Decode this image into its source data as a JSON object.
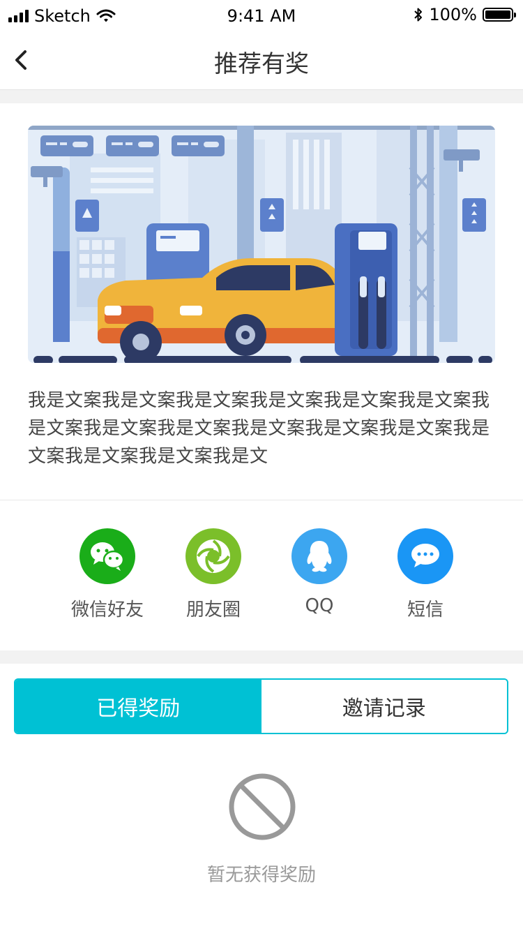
{
  "status_bar": {
    "carrier": "Sketch",
    "time": "9:41 AM",
    "battery": "100%",
    "icons": [
      "signal-icon",
      "wifi-icon",
      "bluetooth-icon",
      "battery-icon"
    ]
  },
  "nav": {
    "title": "推荐有奖",
    "back_icon": "chevron-left-icon"
  },
  "banner": {
    "description": "我是文案我是文案我是文案我是文案我是文案我是文案我是文案我是文案我是文案我是文案我是文案我是文案我是文案我是文案我是文案我是文"
  },
  "share": {
    "items": [
      {
        "label": "微信好友",
        "icon": "wechat-icon",
        "color": "#1aad19"
      },
      {
        "label": "朋友圈",
        "icon": "moments-icon",
        "color": "#7bbf2a"
      },
      {
        "label": "QQ",
        "icon": "qq-icon",
        "color": "#3ca6f0"
      },
      {
        "label": "短信",
        "icon": "sms-icon",
        "color": "#1a96f5"
      }
    ]
  },
  "tabs": {
    "active_label": "已得奖励",
    "inactive_label": "邀请记录",
    "accent_color": "#00c1d4"
  },
  "empty_state": {
    "icon": "no-entry-icon",
    "text": "暂无获得奖励"
  }
}
